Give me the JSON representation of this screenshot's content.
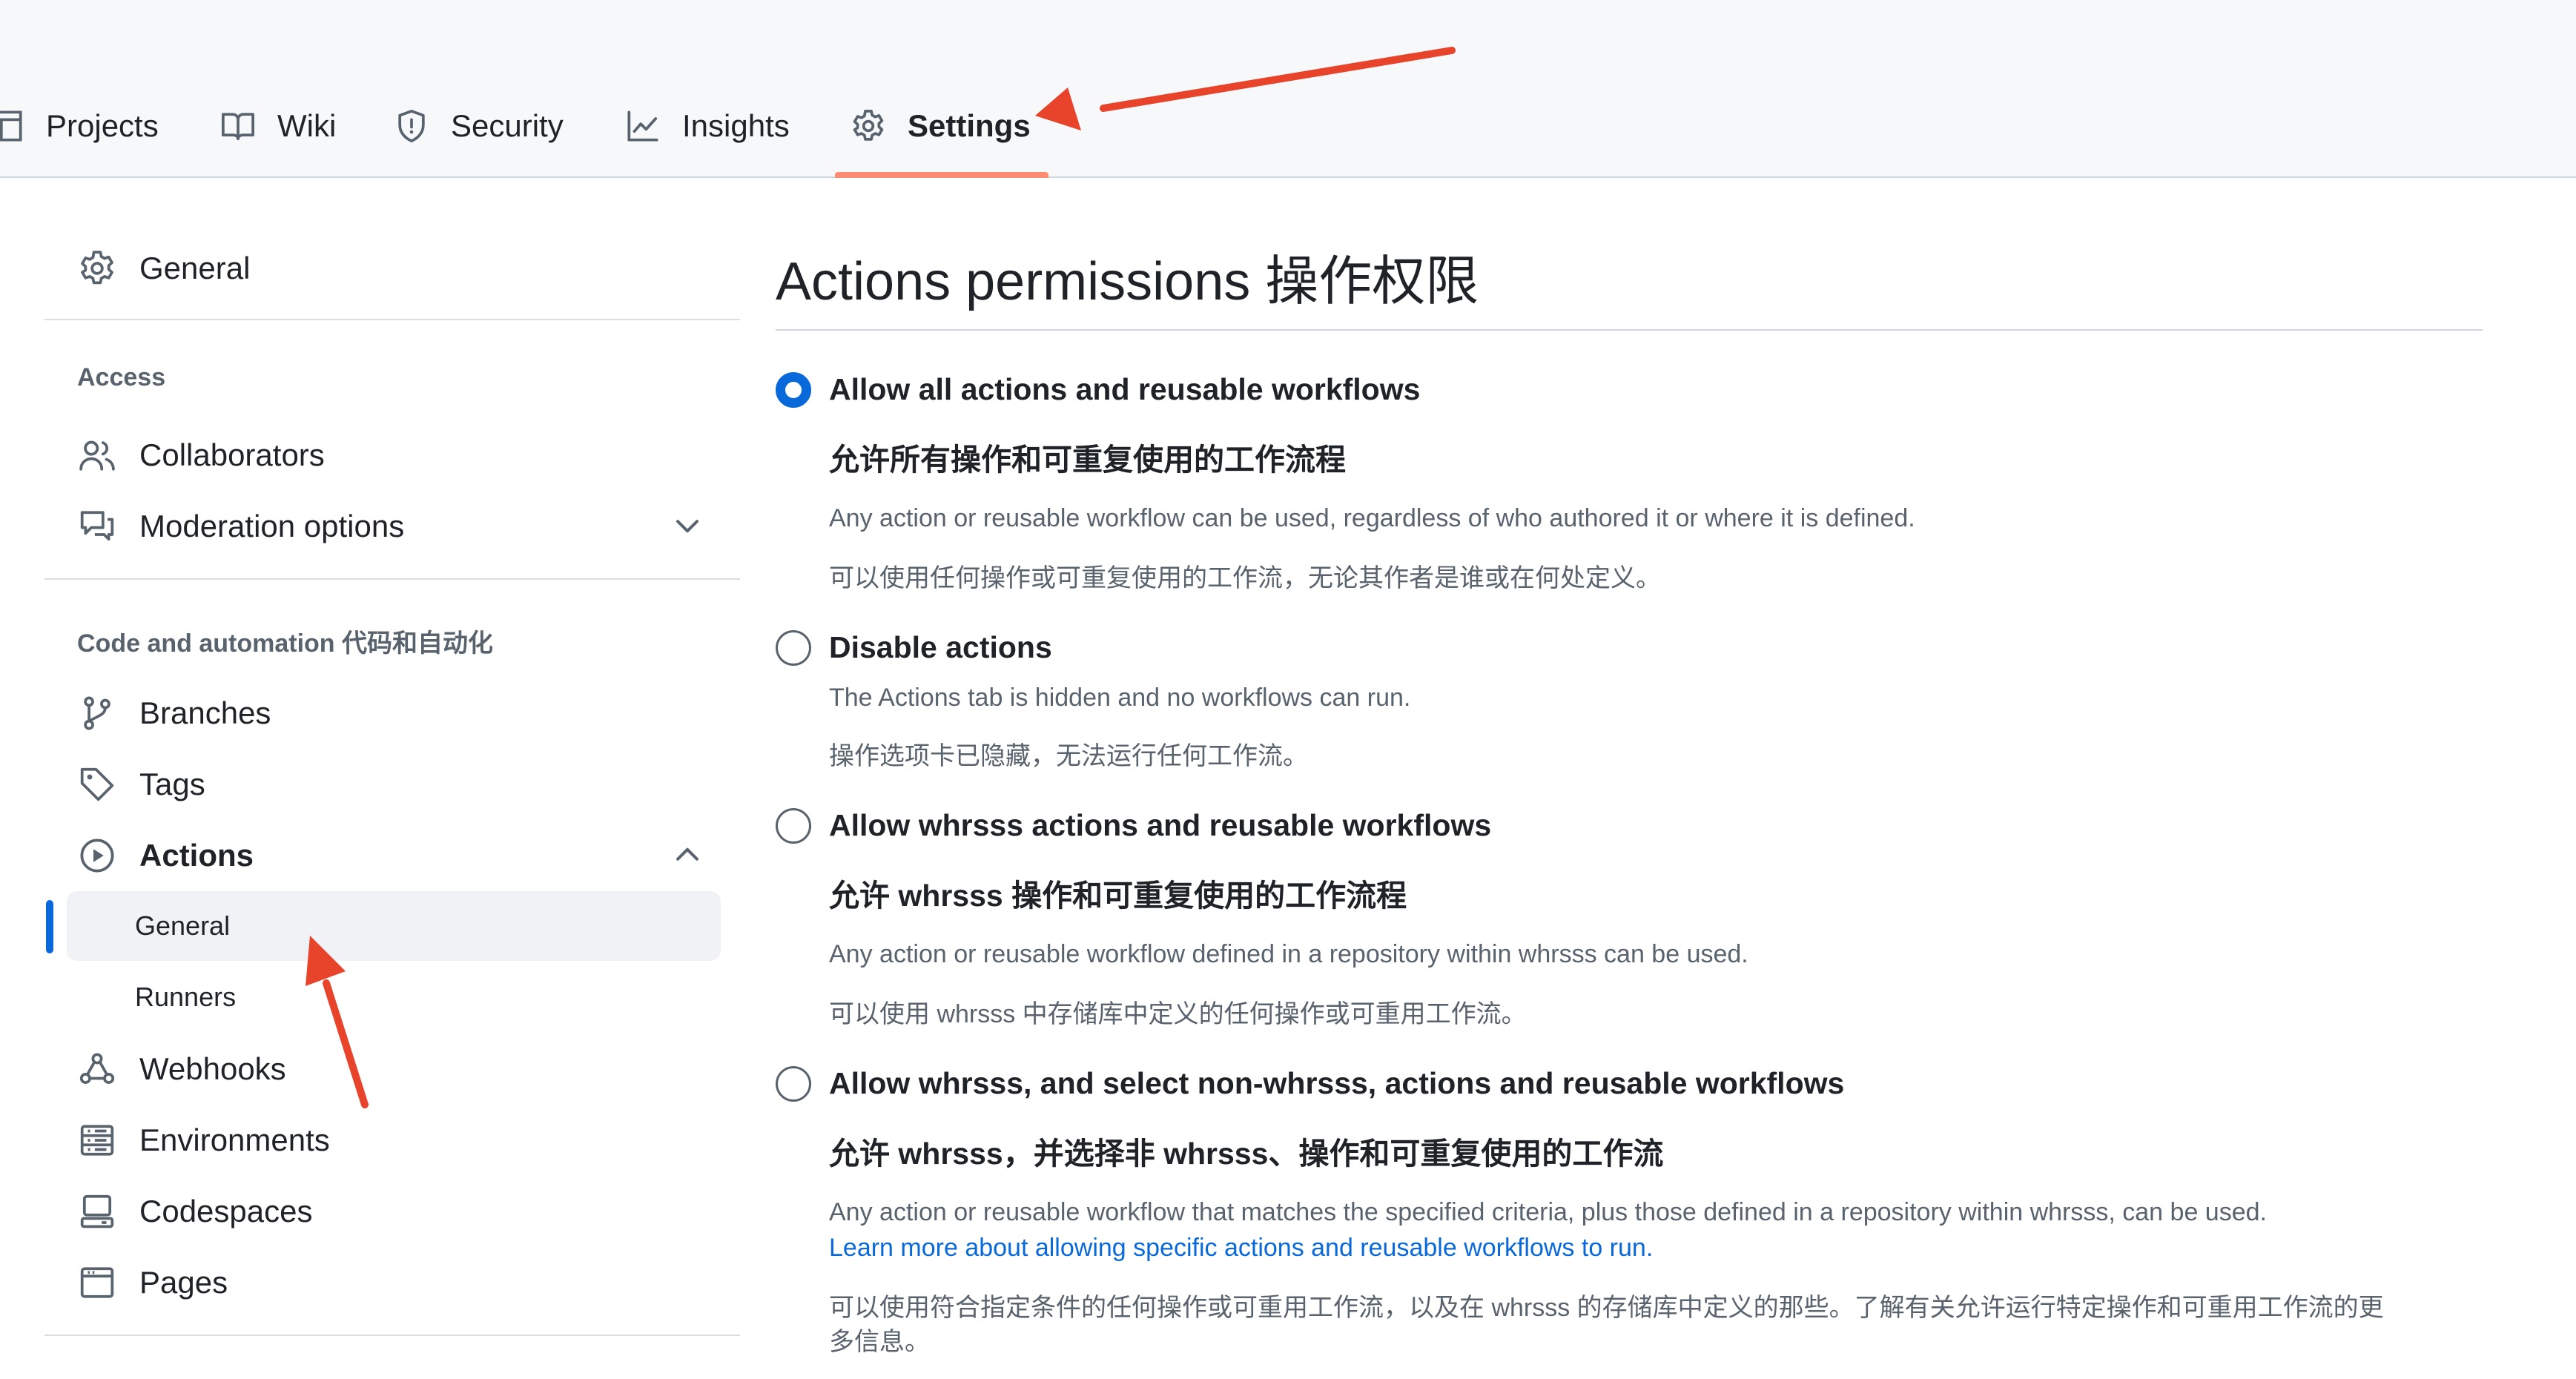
{
  "tabs": [
    {
      "label": "Projects",
      "icon": "table-icon"
    },
    {
      "label": "Wiki",
      "icon": "book-icon"
    },
    {
      "label": "Security",
      "icon": "shield-icon"
    },
    {
      "label": "Insights",
      "icon": "graph-icon"
    },
    {
      "label": "Settings",
      "icon": "gear-icon",
      "active": true
    }
  ],
  "sidebar": {
    "general": "General",
    "access_heading": "Access",
    "collaborators": "Collaborators",
    "moderation": "Moderation options",
    "code_heading": "Code and automation  代码和自动化",
    "branches": "Branches",
    "tags": "Tags",
    "actions": "Actions",
    "actions_general": "General",
    "runners": "Runners",
    "webhooks": "Webhooks",
    "environments": "Environments",
    "codespaces": "Codespaces",
    "pages": "Pages"
  },
  "main": {
    "title": "Actions permissions 操作权限",
    "options": [
      {
        "label": "Allow all actions and reusable workflows",
        "label_cn": "允许所有操作和可重复使用的工作流程",
        "desc": "Any action or reusable workflow can be used, regardless of who authored it or where it is defined.",
        "desc_cn": "可以使用任何操作或可重复使用的工作流，无论其作者是谁或在何处定义。",
        "checked": true
      },
      {
        "label": "Disable actions",
        "desc": "The Actions tab is hidden and no workflows can run.",
        "desc_cn": "操作选项卡已隐藏，无法运行任何工作流。",
        "checked": false
      },
      {
        "label": "Allow whrsss actions and reusable workflows",
        "label_cn": "允许 whrsss 操作和可重复使用的工作流程",
        "desc": "Any action or reusable workflow defined in a repository within whrsss can be used.",
        "desc_cn": "可以使用 whrsss 中存储库中定义的任何操作或可重用工作流。",
        "checked": false
      },
      {
        "label": "Allow whrsss, and select non-whrsss, actions and reusable workflows",
        "label_cn": "允许 whrsss，并选择非 whrsss、操作和可重复使用的工作流",
        "desc": "Any action or reusable workflow that matches the specified criteria, plus those defined in a repository within whrsss, can be used.",
        "link": "Learn more about allowing specific actions and reusable workflows to run.",
        "desc_cn": "可以使用符合指定条件的任何操作或可重用工作流，以及在 whrsss 的存储库中定义的那些。了解有关允许运行特定操作和可重用工作流的更",
        "desc_cn2": "多信息。",
        "checked": false
      }
    ]
  },
  "colors": {
    "accent": "#0969da",
    "tab_underline": "#fd8c73",
    "annotation_arrow": "#e8432b"
  }
}
